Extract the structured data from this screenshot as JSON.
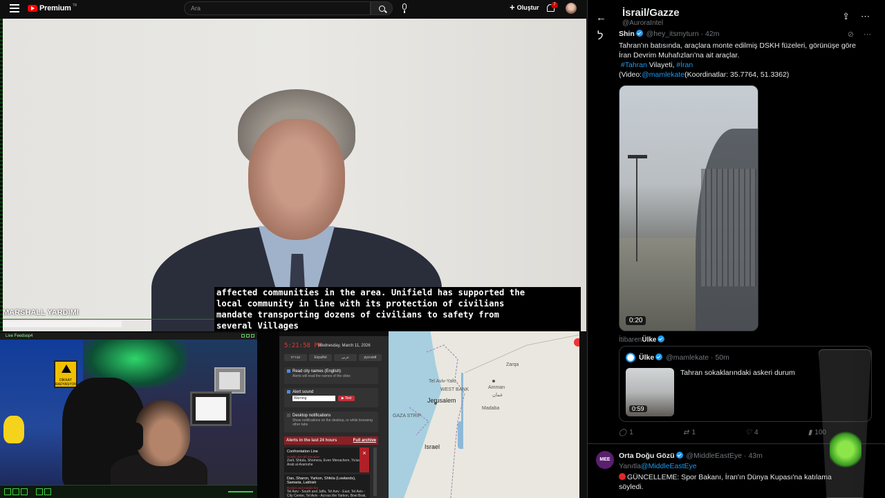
{
  "youtube": {
    "brand": "Premium",
    "brand_sup": "TR",
    "search_placeholder": "Ara",
    "create_label": "Oluştur",
    "notification_count": "7"
  },
  "video": {
    "lower_third_name": "MARSHALL YARDIMI",
    "subtitle_lines": [
      "affected communities in the area. Unifield has supported the",
      "local community in line with its protection of civilians",
      "mandate transporting dozens of civilians to safety from",
      "several Villages"
    ]
  },
  "webcam": {
    "window_title": "Live Feedsep4",
    "sign_text": "DİKKAT RADYASYON"
  },
  "alert_app": {
    "time": "5:21:58 PM",
    "date": "Wednesday, March 11, 2026",
    "languages": [
      "עברית",
      "Español",
      "عربي",
      "русский"
    ],
    "read_city_title": "Read city names (English)",
    "read_city_sub": "Alerts will read the names of the cities",
    "alert_sound_title": "Alert sound",
    "alert_sound_value": "Warning",
    "test_label": "▶ Test",
    "desktop_title": "Desktop notifications",
    "desktop_sub": "Show notifications on the desktop, or while browsing other tabs",
    "alerts_header": "Alerts in the last 24 hours",
    "full_archive": "Full archive",
    "alerts": [
      {
        "title": "Confrontation Line",
        "red": "Hostile aircraft intrusion",
        "body": "Zarit, Shtula, Shomera, Even Menachem, Ya'ara, Arab al-Aramshe"
      },
      {
        "title": "Dan, Sharon, Yarkon, Shfela (Lowlands), Samaria, Lakhish",
        "red": "Rocket and missile fire",
        "body": "Tel Aviv - South and Jaffa, Tel Aviv - East, Tel Aviv - City Center, Tel Aviv - Across the Yarkon, Bnei Brak, Givat"
      }
    ]
  },
  "map": {
    "labels": {
      "tel_aviv": "Tel Aviv-Yafo",
      "west_bank": "WEST BANK",
      "jerusalem": "Jerusalem",
      "amman": "Amman",
      "amman_ar": "عمان",
      "gaza": "GAZA STRIP",
      "israel": "Israel",
      "zarqa": "Zarqa",
      "madaba": "Madaba"
    }
  },
  "twitter": {
    "title": "İsrail/Gazze",
    "handle": "@AuroraIntel",
    "tweet1": {
      "name": "Shin",
      "handle": "@hey_itsmyturn",
      "time": "42m",
      "line1": "Tahran'ın batısında, araçlara monte edilmiş DSKH füzeleri, görünüşe göre",
      "line2": "İran Devrim Muhafızları'na ait araçlar.",
      "hashtag1": "#Tahran",
      "mid": " Vilayeti, ",
      "hashtag2": "#İran",
      "video_prefix": "(Video:",
      "video_mention": "@mamlekate",
      "coords": "(Koordinatlar: 35.7764, 51.3362)",
      "duration": "0:20",
      "from_prefix": "İtibaren",
      "from_name": "Ülke"
    },
    "quote": {
      "name": "Ülke",
      "handle": "@mamlekate",
      "time": "50m",
      "text": "Tahran sokaklarındaki askeri durum",
      "duration": "0:59"
    },
    "actions": {
      "replies": "1",
      "retweets": "1",
      "likes": "4",
      "views": "100"
    },
    "tweet2": {
      "name": "Orta Doğu Gözü",
      "handle": "@MiddleEastEye",
      "time": "43m",
      "avatar_text": "MEE",
      "reply_prefix": "Yanıtla",
      "reply_to": "@MiddleEastEye",
      "text_line1": "GÜNCELLEME: Spor Bakanı, İran'ın Dünya Kupası'na katılama",
      "text_line2": "söyledi."
    }
  },
  "colors": {
    "youtube_red": "#ff0000",
    "twitter_blue": "#1d9bf0",
    "alert_red": "#e03a3a"
  }
}
